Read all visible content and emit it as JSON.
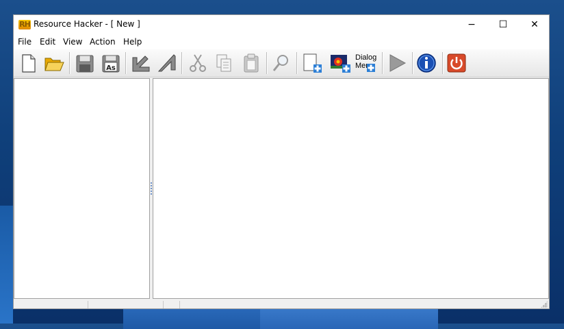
{
  "window": {
    "app_logo_text": "RH",
    "title": "Resource Hacker - [ New ]",
    "controls": {
      "minimize": "−",
      "maximize": "☐",
      "close": "✕"
    }
  },
  "menu": {
    "items": [
      {
        "label": "File"
      },
      {
        "label": "Edit"
      },
      {
        "label": "View"
      },
      {
        "label": "Action"
      },
      {
        "label": "Help"
      }
    ]
  },
  "toolbar": {
    "dialog_label_line1": "Dialog",
    "dialog_label_line2": "Mer",
    "icons": [
      "new-file-icon",
      "open-folder-icon",
      "save-icon",
      "save-as-icon",
      "back-arrow-icon",
      "forward-arrow-icon",
      "cut-icon",
      "copy-icon",
      "paste-icon",
      "find-icon",
      "add-resource-icon",
      "add-image-icon",
      "dialog-merger-icon",
      "run-script-icon",
      "about-icon",
      "exit-icon"
    ],
    "save_as_text": "As"
  },
  "colors": {
    "desktop": "#1b4f8c",
    "window_bg": "#f0f0f0",
    "pane_bg": "#ffffff",
    "info_blue": "#1a4fb4",
    "exit_red": "#d84a2a",
    "folder_yellow": "#f2c23a"
  }
}
